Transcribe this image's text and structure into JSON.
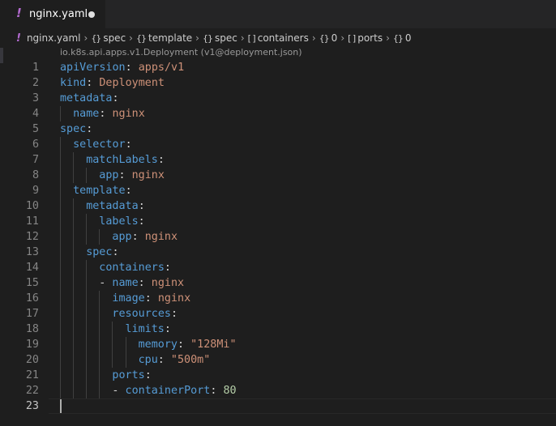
{
  "tab": {
    "icon": "!",
    "label": "nginx.yaml",
    "dirty": true
  },
  "breadcrumb": {
    "file_icon": "!",
    "items": [
      {
        "glyph": "",
        "label": "nginx.yaml"
      },
      {
        "glyph": "{}",
        "label": "spec"
      },
      {
        "glyph": "{}",
        "label": "template"
      },
      {
        "glyph": "{}",
        "label": "spec"
      },
      {
        "glyph": "[ ]",
        "label": "containers"
      },
      {
        "glyph": "{}",
        "label": "0"
      },
      {
        "glyph": "[ ]",
        "label": "ports"
      },
      {
        "glyph": "{}",
        "label": "0"
      }
    ]
  },
  "codelens": "io.k8s.api.apps.v1.Deployment (v1@deployment.json)",
  "lines": [
    {
      "n": "1",
      "indent": 0,
      "tokens": [
        [
          "key",
          "apiVersion"
        ],
        [
          "punc",
          ": "
        ],
        [
          "str",
          "apps/v1"
        ]
      ]
    },
    {
      "n": "2",
      "indent": 0,
      "tokens": [
        [
          "key",
          "kind"
        ],
        [
          "punc",
          ": "
        ],
        [
          "str",
          "Deployment"
        ]
      ]
    },
    {
      "n": "3",
      "indent": 0,
      "tokens": [
        [
          "key",
          "metadata"
        ],
        [
          "punc",
          ":"
        ]
      ]
    },
    {
      "n": "4",
      "indent": 1,
      "tokens": [
        [
          "key",
          "name"
        ],
        [
          "punc",
          ": "
        ],
        [
          "str",
          "nginx"
        ]
      ]
    },
    {
      "n": "5",
      "indent": 0,
      "tokens": [
        [
          "key",
          "spec"
        ],
        [
          "punc",
          ":"
        ]
      ]
    },
    {
      "n": "6",
      "indent": 1,
      "tokens": [
        [
          "key",
          "selector"
        ],
        [
          "punc",
          ":"
        ]
      ]
    },
    {
      "n": "7",
      "indent": 2,
      "tokens": [
        [
          "key",
          "matchLabels"
        ],
        [
          "punc",
          ":"
        ]
      ]
    },
    {
      "n": "8",
      "indent": 3,
      "tokens": [
        [
          "key",
          "app"
        ],
        [
          "punc",
          ": "
        ],
        [
          "str",
          "nginx"
        ]
      ]
    },
    {
      "n": "9",
      "indent": 1,
      "tokens": [
        [
          "key",
          "template"
        ],
        [
          "punc",
          ":"
        ]
      ]
    },
    {
      "n": "10",
      "indent": 2,
      "tokens": [
        [
          "key",
          "metadata"
        ],
        [
          "punc",
          ":"
        ]
      ]
    },
    {
      "n": "11",
      "indent": 3,
      "tokens": [
        [
          "key",
          "labels"
        ],
        [
          "punc",
          ":"
        ]
      ]
    },
    {
      "n": "12",
      "indent": 4,
      "tokens": [
        [
          "key",
          "app"
        ],
        [
          "punc",
          ": "
        ],
        [
          "str",
          "nginx"
        ]
      ]
    },
    {
      "n": "13",
      "indent": 2,
      "tokens": [
        [
          "key",
          "spec"
        ],
        [
          "punc",
          ":"
        ]
      ]
    },
    {
      "n": "14",
      "indent": 3,
      "tokens": [
        [
          "key",
          "containers"
        ],
        [
          "punc",
          ":"
        ]
      ]
    },
    {
      "n": "15",
      "indent": 3,
      "tokens": [
        [
          "punc",
          "- "
        ],
        [
          "key",
          "name"
        ],
        [
          "punc",
          ": "
        ],
        [
          "str",
          "nginx"
        ]
      ]
    },
    {
      "n": "16",
      "indent": 4,
      "tokens": [
        [
          "key",
          "image"
        ],
        [
          "punc",
          ": "
        ],
        [
          "str",
          "nginx"
        ]
      ]
    },
    {
      "n": "17",
      "indent": 4,
      "tokens": [
        [
          "key",
          "resources"
        ],
        [
          "punc",
          ":"
        ]
      ]
    },
    {
      "n": "18",
      "indent": 5,
      "tokens": [
        [
          "key",
          "limits"
        ],
        [
          "punc",
          ":"
        ]
      ]
    },
    {
      "n": "19",
      "indent": 6,
      "tokens": [
        [
          "key",
          "memory"
        ],
        [
          "punc",
          ": "
        ],
        [
          "str",
          "\"128Mi\""
        ]
      ]
    },
    {
      "n": "20",
      "indent": 6,
      "tokens": [
        [
          "key",
          "cpu"
        ],
        [
          "punc",
          ": "
        ],
        [
          "str",
          "\"500m\""
        ]
      ]
    },
    {
      "n": "21",
      "indent": 4,
      "tokens": [
        [
          "key",
          "ports"
        ],
        [
          "punc",
          ":"
        ]
      ]
    },
    {
      "n": "22",
      "indent": 4,
      "tokens": [
        [
          "punc",
          "- "
        ],
        [
          "key",
          "containerPort"
        ],
        [
          "punc",
          ": "
        ],
        [
          "num",
          "80"
        ]
      ]
    },
    {
      "n": "23",
      "indent": 0,
      "tokens": []
    }
  ],
  "current_line": "23",
  "colors": {
    "key": "#569cd6",
    "string": "#ce9178",
    "number": "#b5cea8",
    "yaml_icon": "#b36ad0"
  }
}
